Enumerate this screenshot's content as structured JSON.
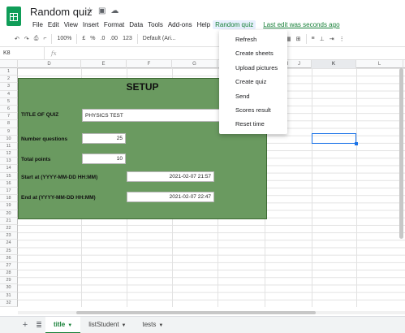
{
  "app": {
    "doc_title": "Random quiz"
  },
  "menu": {
    "items": [
      "File",
      "Edit",
      "View",
      "Insert",
      "Format",
      "Data",
      "Tools",
      "Add-ons",
      "Help",
      "Random quiz"
    ],
    "last_edit": "Last edit was seconds ago"
  },
  "toolbar": {
    "zoom": "100%",
    "percent": "%",
    "dec0": ".0",
    "dec00": ".00",
    "numfmt": "123",
    "currency": "£",
    "font": "Default (Ari..."
  },
  "formula_bar": {
    "name_box": "K8",
    "fx": "fx",
    "value": ""
  },
  "columns": [
    "D",
    "E",
    "F",
    "G",
    "H",
    "I",
    "J",
    "K",
    "L"
  ],
  "rows": [
    "1",
    "2",
    "3",
    "4",
    "5",
    "6",
    "7",
    "8",
    "9",
    "10",
    "11",
    "12",
    "13",
    "14",
    "15",
    "16",
    "17",
    "18",
    "19",
    "20",
    "21",
    "22",
    "23",
    "24",
    "25",
    "26",
    "27",
    "28",
    "29",
    "30",
    "31",
    "32"
  ],
  "setup": {
    "title": "SETUP",
    "quiz_title_label": "TITLE OF QUIZ",
    "quiz_title_value": "PHYSICS TEST",
    "num_questions_label": "Number questions",
    "num_questions_value": "25",
    "total_points_label": "Total points",
    "total_points_value": "10",
    "start_label": "Start at (YYYY-MM-DD HH:MM)",
    "start_value": "2021-02-07 21:57",
    "end_label": "End at (YYYY-MM-DD HH:MM)",
    "end_value": "2021-02-07 22:47"
  },
  "dropdown": {
    "items": [
      "Refresh",
      "Create sheets",
      "Upload pictures",
      "Create quiz",
      "Send",
      "Scores result",
      "Reset time"
    ]
  },
  "sheets": {
    "tabs": [
      "title",
      "listStudent",
      "tests"
    ],
    "active": "title"
  },
  "colors": {
    "accent": "#188038",
    "setup_bg": "#6a9a60",
    "selection": "#1a73e8"
  }
}
